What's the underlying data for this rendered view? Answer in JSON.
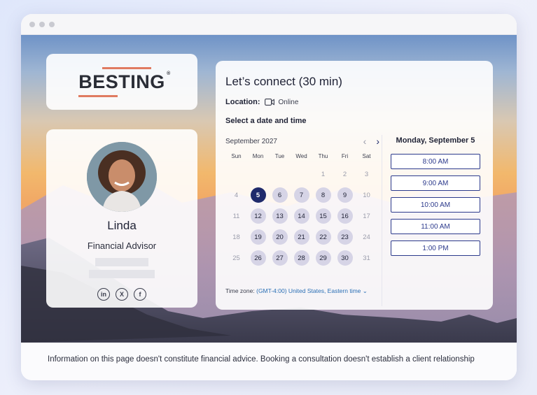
{
  "brand": {
    "logo_text": "BESTING",
    "accent": "#e07b61"
  },
  "profile": {
    "name": "Linda",
    "role": "Financial Advisor",
    "socials": [
      {
        "icon": "linkedin-icon",
        "glyph": "in"
      },
      {
        "icon": "x-icon",
        "glyph": "X"
      },
      {
        "icon": "facebook-icon",
        "glyph": "f"
      }
    ]
  },
  "booking": {
    "title": "Let’s connect (30 min)",
    "location_label": "Location:",
    "location_value": "Online",
    "select_label": "Select a date and time",
    "month": "September 2027",
    "weekdays": [
      "Sun",
      "Mon",
      "Tue",
      "Wed",
      "Thu",
      "Fri",
      "Sat"
    ],
    "days": [
      {
        "d": "",
        "s": "empty"
      },
      {
        "d": "",
        "s": "empty"
      },
      {
        "d": "",
        "s": "empty"
      },
      {
        "d": "",
        "s": "empty"
      },
      {
        "d": "1",
        "s": "muted"
      },
      {
        "d": "2",
        "s": "muted"
      },
      {
        "d": "3",
        "s": "muted"
      },
      {
        "d": "4",
        "s": "muted"
      },
      {
        "d": "5",
        "s": "selected"
      },
      {
        "d": "6",
        "s": "available"
      },
      {
        "d": "7",
        "s": "available"
      },
      {
        "d": "8",
        "s": "available"
      },
      {
        "d": "9",
        "s": "available"
      },
      {
        "d": "10",
        "s": "muted"
      },
      {
        "d": "11",
        "s": "muted"
      },
      {
        "d": "12",
        "s": "available"
      },
      {
        "d": "13",
        "s": "available"
      },
      {
        "d": "14",
        "s": "available"
      },
      {
        "d": "15",
        "s": "available"
      },
      {
        "d": "16",
        "s": "available"
      },
      {
        "d": "17",
        "s": "muted"
      },
      {
        "d": "18",
        "s": "muted"
      },
      {
        "d": "19",
        "s": "available"
      },
      {
        "d": "20",
        "s": "available"
      },
      {
        "d": "21",
        "s": "available"
      },
      {
        "d": "22",
        "s": "available"
      },
      {
        "d": "23",
        "s": "available"
      },
      {
        "d": "24",
        "s": "muted"
      },
      {
        "d": "25",
        "s": "muted"
      },
      {
        "d": "26",
        "s": "available"
      },
      {
        "d": "27",
        "s": "available"
      },
      {
        "d": "28",
        "s": "available"
      },
      {
        "d": "29",
        "s": "available"
      },
      {
        "d": "30",
        "s": "available"
      },
      {
        "d": "31",
        "s": "muted"
      }
    ],
    "timezone_label": "Time zone:",
    "timezone_value": "(GMT-4:00) United States, Eastern time",
    "selected_date": "Monday, September 5",
    "slots": [
      "8:00 AM",
      "9:00 AM",
      "10:00 AM",
      "11:00 AM",
      "1:00 PM"
    ]
  },
  "footer": {
    "disclaimer": "Information on this page doesn't constitute financial advice. Booking a consultation doesn't establish a client relationship"
  }
}
